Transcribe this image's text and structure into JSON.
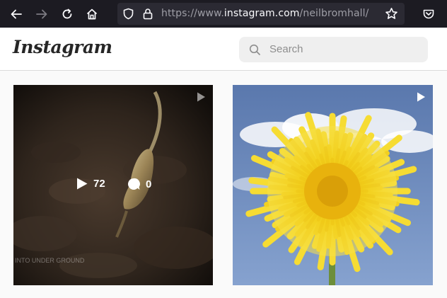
{
  "browser": {
    "url_prefix": "https://www.",
    "url_host": "instagram.com",
    "url_path": "/neilbromhall/"
  },
  "header": {
    "logo_text": "Instagram",
    "search_placeholder": "Search"
  },
  "posts": [
    {
      "type": "video",
      "plays": "72",
      "comments": "0",
      "watermark": "INTO UNDER GROUND"
    },
    {
      "type": "video"
    }
  ],
  "colors": {
    "browser_bg": "#1c1b22",
    "urlbar_bg": "#2b2a33",
    "sky": "#6f8fc0",
    "petal": "#f2d51e"
  }
}
